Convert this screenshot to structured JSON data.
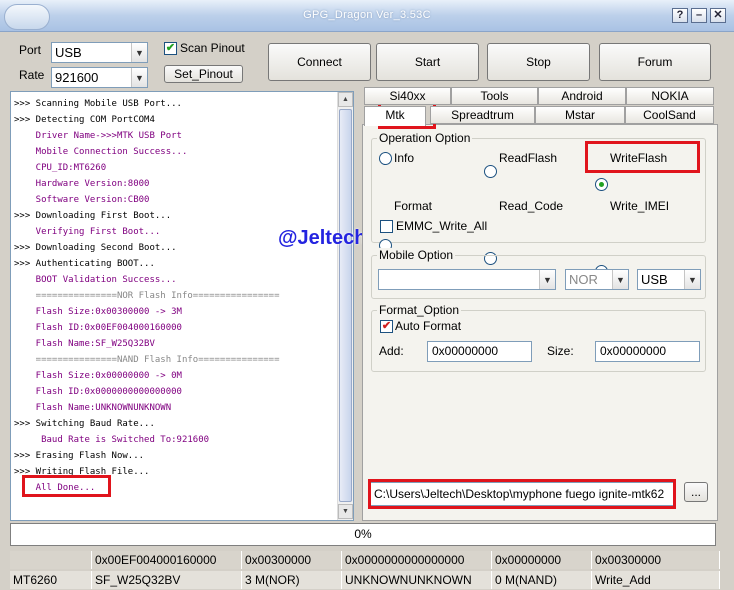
{
  "window": {
    "title": "GPG_Dragon Ver_3.53C"
  },
  "port": {
    "label": "Port",
    "value": "USB"
  },
  "rate": {
    "label": "Rate",
    "value": "921600"
  },
  "scan_pinout": {
    "label": "Scan Pinout",
    "checked": true
  },
  "set_pinout": {
    "label": "Set_Pinout"
  },
  "toolbar": {
    "connect": "Connect",
    "start": "Start",
    "stop": "Stop",
    "forum": "Forum"
  },
  "log": [
    {
      "text": ">>> Scanning Mobile USB Port...",
      "tone": "black"
    },
    {
      "text": ">>> Detecting COM PortCOM4",
      "tone": "black"
    },
    {
      "text": "    Driver Name->>>MTK USB Port",
      "tone": "purple"
    },
    {
      "text": "    Mobile Connection Success...",
      "tone": "purple"
    },
    {
      "text": "    CPU_ID:MT6260",
      "tone": "purple"
    },
    {
      "text": "    Hardware Version:8000",
      "tone": "purple"
    },
    {
      "text": "    Software Version:CB00",
      "tone": "purple"
    },
    {
      "text": ">>> Downloading First Boot...",
      "tone": "black"
    },
    {
      "text": "    Verifying First Boot...",
      "tone": "purple"
    },
    {
      "text": ">>> Downloading Second Boot...",
      "tone": "black"
    },
    {
      "text": ">>> Authenticating BOOT...",
      "tone": "black"
    },
    {
      "text": "    BOOT Validation Success...",
      "tone": "purple"
    },
    {
      "text": "    ===============NOR Flash Info================",
      "tone": "grey"
    },
    {
      "text": "    Flash Size:0x00300000 -> 3M",
      "tone": "purple"
    },
    {
      "text": "    Flash ID:0x00EF004000160000",
      "tone": "purple"
    },
    {
      "text": "    Flash Name:SF_W25Q32BV",
      "tone": "purple"
    },
    {
      "text": "    ===============NAND Flash Info===============",
      "tone": "grey"
    },
    {
      "text": "    Flash Size:0x00000000 -> 0M",
      "tone": "purple"
    },
    {
      "text": "    Flash ID:0x0000000000000000",
      "tone": "purple"
    },
    {
      "text": "    Flash Name:UNKNOWNUNKNOWN",
      "tone": "purple"
    },
    {
      "text": ">>> Switching Baud Rate...",
      "tone": "black"
    },
    {
      "text": "     Baud Rate is Switched To:921600",
      "tone": "purple"
    },
    {
      "text": ">>> Erasing Flash Now...",
      "tone": "black"
    },
    {
      "text": ">>> Writing Flash File...",
      "tone": "black"
    },
    {
      "text": "    All Done...",
      "tone": "purple"
    }
  ],
  "watermark": "@Jeltech",
  "tabs_row1": [
    "Si40xx",
    "Tools",
    "Android",
    "NOKIA"
  ],
  "tabs_row2": [
    "Mtk",
    "Spreadtrum",
    "Mstar",
    "CoolSand"
  ],
  "active_tab": "Mtk",
  "operation": {
    "title": "Operation Option",
    "options": [
      "Info",
      "ReadFlash",
      "WriteFlash",
      "Format",
      "Read_Code",
      "Write_IMEI"
    ],
    "selected": "WriteFlash",
    "emmc_label": "EMMC_Write_All",
    "emmc_checked": false
  },
  "mobile": {
    "title": "Mobile Option",
    "model": "",
    "flash_type": "NOR",
    "conn": "USB"
  },
  "format": {
    "title": "Format_Option",
    "auto_label": "Auto Format",
    "auto_checked": true,
    "add_label": "Add:",
    "add_value": "0x00000000",
    "size_label": "Size:",
    "size_value": "0x00000000"
  },
  "file": {
    "path": "C:\\Users\\Jeltech\\Desktop\\myphone fuego ignite-mtk62",
    "browse": "..."
  },
  "progress": {
    "percent": 0,
    "label": "0%"
  },
  "status": {
    "row1": [
      "",
      "0x00EF004000160000",
      "0x00300000",
      "0x0000000000000000",
      "0x00000000",
      "0x00300000"
    ],
    "row2": [
      "MT6260",
      "SF_W25Q32BV",
      "3 M(NOR)",
      "UNKNOWNUNKNOWN",
      "0 M(NAND)",
      "Write_Add"
    ]
  },
  "colors": {
    "highlight": "#e0141c",
    "check_green": "#21a121",
    "watermark": "#2424e0",
    "log_purple": "#800080"
  }
}
